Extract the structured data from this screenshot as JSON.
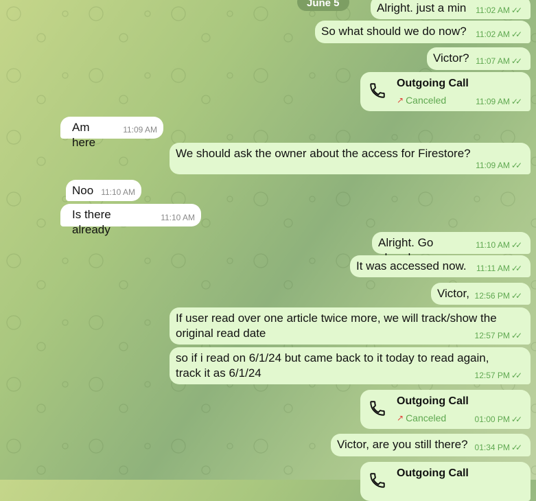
{
  "date_label": "June 5",
  "messages": [
    {
      "id": "m1",
      "dir": "out",
      "type": "text",
      "text": "Alright. just a min",
      "time": "11:02 AM"
    },
    {
      "id": "m2",
      "dir": "out",
      "type": "text",
      "text": "So what should we do now?",
      "time": "11:02 AM"
    },
    {
      "id": "m3",
      "dir": "out",
      "type": "text",
      "text": "Victor?",
      "time": "11:07 AM"
    },
    {
      "id": "m4",
      "dir": "out",
      "type": "call",
      "title": "Outgoing Call",
      "status": "Canceled",
      "time": "11:09 AM"
    },
    {
      "id": "m5",
      "dir": "in",
      "type": "text",
      "text": "Am here",
      "time": "11:09 AM"
    },
    {
      "id": "m6",
      "dir": "out",
      "type": "text",
      "text": "We should ask the owner about the access for Firestore?",
      "time": "11:09 AM"
    },
    {
      "id": "m7",
      "dir": "in",
      "type": "text",
      "text": "Noo",
      "time": "11:10 AM"
    },
    {
      "id": "m8",
      "dir": "in",
      "type": "text",
      "text": "Is there already",
      "time": "11:10 AM"
    },
    {
      "id": "m9",
      "dir": "out",
      "type": "text",
      "text": "Alright. Go ahead",
      "time": "11:10 AM"
    },
    {
      "id": "m10",
      "dir": "out",
      "type": "text",
      "text": "It was accessed now.",
      "time": "11:11 AM"
    },
    {
      "id": "m11",
      "dir": "out",
      "type": "text",
      "text": "Victor,",
      "time": "12:56 PM"
    },
    {
      "id": "m12",
      "dir": "out",
      "type": "text",
      "text": "If user read over one article twice more, we will track/show the original read date",
      "time": "12:57 PM"
    },
    {
      "id": "m13",
      "dir": "out",
      "type": "text",
      "text": "so if i read on 6/1/24 but came back to it today to read again, track it as 6/1/24",
      "time": "12:57 PM"
    },
    {
      "id": "m14",
      "dir": "out",
      "type": "call",
      "title": "Outgoing Call",
      "status": "Canceled",
      "time": "01:00 PM"
    },
    {
      "id": "m15",
      "dir": "out",
      "type": "text",
      "text": "Victor, are you still there?",
      "time": "01:34 PM"
    },
    {
      "id": "m16",
      "dir": "out",
      "type": "call",
      "title": "Outgoing Call",
      "status": "",
      "time": ""
    }
  ]
}
